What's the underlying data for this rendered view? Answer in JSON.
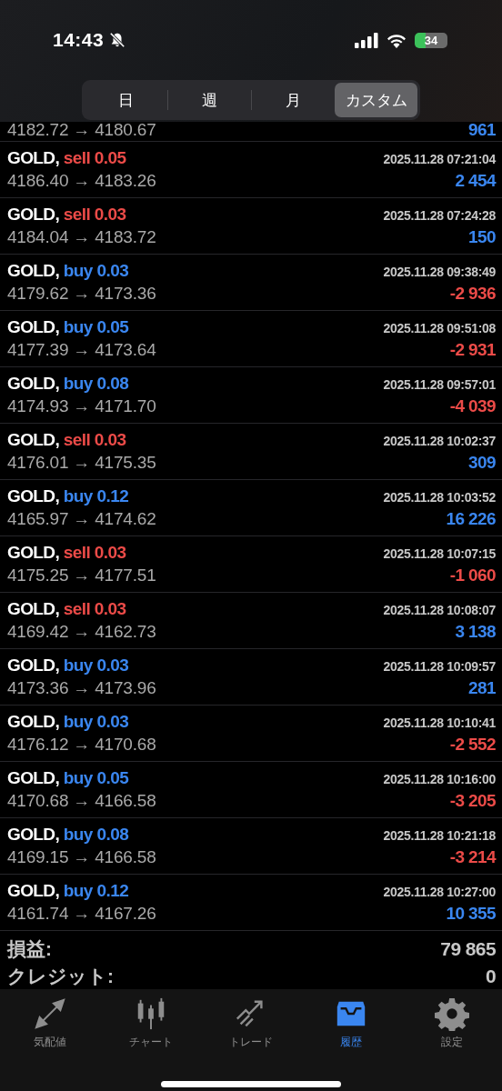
{
  "status_bar": {
    "time": "14:43",
    "battery": "34"
  },
  "period_tabs": [
    {
      "label": "日",
      "selected": false
    },
    {
      "label": "週",
      "selected": false
    },
    {
      "label": "月",
      "selected": false
    },
    {
      "label": "カスタム",
      "selected": true
    }
  ],
  "partial_row": {
    "prices": "4182.72 → 4180.67",
    "profit": "961",
    "loss": false
  },
  "deals": [
    {
      "symbol": "GOLD,",
      "trade": "sell 0.05",
      "kind": "sell",
      "time": "2025.11.28 07:21:04",
      "prices": "4186.40 → 4183.26",
      "profit": "2 454",
      "loss": false
    },
    {
      "symbol": "GOLD,",
      "trade": "sell 0.03",
      "kind": "sell",
      "time": "2025.11.28 07:24:28",
      "prices": "4184.04 → 4183.72",
      "profit": "150",
      "loss": false
    },
    {
      "symbol": "GOLD,",
      "trade": "buy 0.03",
      "kind": "buy",
      "time": "2025.11.28 09:38:49",
      "prices": "4179.62 → 4173.36",
      "profit": "-2 936",
      "loss": true
    },
    {
      "symbol": "GOLD,",
      "trade": "buy 0.05",
      "kind": "buy",
      "time": "2025.11.28 09:51:08",
      "prices": "4177.39 → 4173.64",
      "profit": "-2 931",
      "loss": true
    },
    {
      "symbol": "GOLD,",
      "trade": "buy 0.08",
      "kind": "buy",
      "time": "2025.11.28 09:57:01",
      "prices": "4174.93 → 4171.70",
      "profit": "-4 039",
      "loss": true
    },
    {
      "symbol": "GOLD,",
      "trade": "sell 0.03",
      "kind": "sell",
      "time": "2025.11.28 10:02:37",
      "prices": "4176.01 → 4175.35",
      "profit": "309",
      "loss": false
    },
    {
      "symbol": "GOLD,",
      "trade": "buy 0.12",
      "kind": "buy",
      "time": "2025.11.28 10:03:52",
      "prices": "4165.97 → 4174.62",
      "profit": "16 226",
      "loss": false
    },
    {
      "symbol": "GOLD,",
      "trade": "sell 0.03",
      "kind": "sell",
      "time": "2025.11.28 10:07:15",
      "prices": "4175.25 → 4177.51",
      "profit": "-1 060",
      "loss": true
    },
    {
      "symbol": "GOLD,",
      "trade": "sell 0.03",
      "kind": "sell",
      "time": "2025.11.28 10:08:07",
      "prices": "4169.42 → 4162.73",
      "profit": "3 138",
      "loss": false
    },
    {
      "symbol": "GOLD,",
      "trade": "buy 0.03",
      "kind": "buy",
      "time": "2025.11.28 10:09:57",
      "prices": "4173.36 → 4173.96",
      "profit": "281",
      "loss": false
    },
    {
      "symbol": "GOLD,",
      "trade": "buy 0.03",
      "kind": "buy",
      "time": "2025.11.28 10:10:41",
      "prices": "4176.12 → 4170.68",
      "profit": "-2 552",
      "loss": true
    },
    {
      "symbol": "GOLD,",
      "trade": "buy 0.05",
      "kind": "buy",
      "time": "2025.11.28 10:16:00",
      "prices": "4170.68 → 4166.58",
      "profit": "-3 205",
      "loss": true
    },
    {
      "symbol": "GOLD,",
      "trade": "buy 0.08",
      "kind": "buy",
      "time": "2025.11.28 10:21:18",
      "prices": "4169.15 → 4166.58",
      "profit": "-3 214",
      "loss": true
    },
    {
      "symbol": "GOLD,",
      "trade": "buy 0.12",
      "kind": "buy",
      "time": "2025.11.28 10:27:00",
      "prices": "4161.74 → 4167.26",
      "profit": "10 355",
      "loss": false
    }
  ],
  "summary": [
    {
      "label": "損益:",
      "value": "79 865"
    },
    {
      "label": "クレジット:",
      "value": "0"
    }
  ],
  "tab_bar": [
    {
      "label": "気配値",
      "kind": "quotes",
      "selected": false
    },
    {
      "label": "チャート",
      "kind": "chart",
      "selected": false
    },
    {
      "label": "トレード",
      "kind": "trade",
      "selected": false
    },
    {
      "label": "履歴",
      "kind": "history",
      "selected": true
    },
    {
      "label": "設定",
      "kind": "settings",
      "selected": false
    }
  ]
}
